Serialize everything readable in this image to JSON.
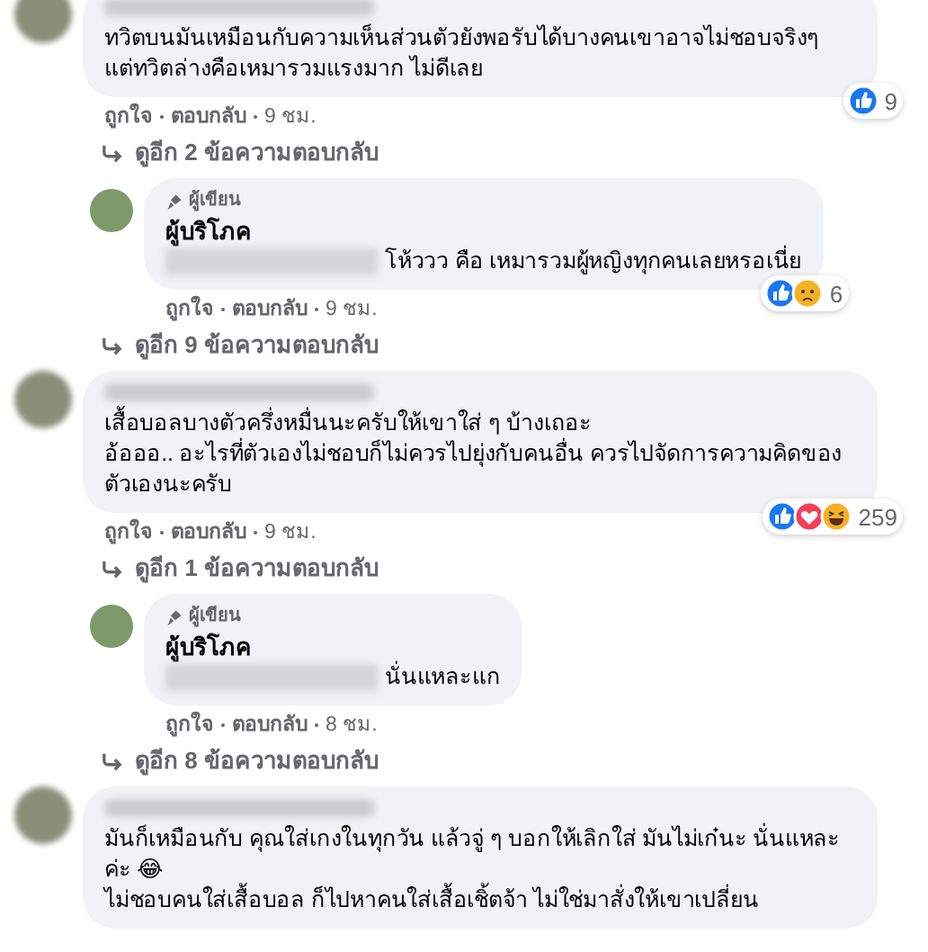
{
  "thread": [
    {
      "kind": "comment",
      "paragraphs": [
        "ทวิตบนมันเหมือนกับความเห็นส่วนตัวยังพอรับได้บางคนเขาอาจไม่ชอบจริงๆ",
        "แต่ทวิตล่างคือเหมารวมแรงมาก ไม่ดีเลย"
      ],
      "reactions": [
        {
          "kind": "like"
        }
      ],
      "reaction_count": "9",
      "actions": [
        "ถูกใจ",
        "ตอบกลับ",
        "9 ชม."
      ]
    },
    {
      "kind": "more_replies",
      "label": "ดูอีก 2 ข้อความตอบกลับ"
    },
    {
      "kind": "reply",
      "badge": "ผู้เขียน",
      "author": "ผู้บริโภค",
      "text": "โห้ววว คือ เหมารวมผู้หญิงทุกคนเลยหรอเนี่ย",
      "reactions": [
        {
          "kind": "like"
        },
        {
          "kind": "sad"
        }
      ],
      "reaction_count": "6",
      "actions": [
        "ถูกใจ",
        "ตอบกลับ",
        "9 ชม."
      ]
    },
    {
      "kind": "more_replies",
      "label": "ดูอีก 9 ข้อความตอบกลับ"
    },
    {
      "kind": "comment",
      "paragraphs": [
        "เสื้อบอลบางตัวครึ่งหมื่นนะครับให้เขาใส่ ๆ บ้างเถอะ",
        "อ้อออ.. อะไรที่ตัวเองไม่ชอบก็ไม่ควรไปยุ่งกับคนอื่น ควรไปจัดการความคิดของตัวเองนะครับ"
      ],
      "reactions": [
        {
          "kind": "like"
        },
        {
          "kind": "love"
        },
        {
          "kind": "haha"
        }
      ],
      "reaction_count": "259",
      "actions": [
        "ถูกใจ",
        "ตอบกลับ",
        "9 ชม."
      ]
    },
    {
      "kind": "more_replies",
      "label": "ดูอีก 1 ข้อความตอบกลับ"
    },
    {
      "kind": "reply",
      "badge": "ผู้เขียน",
      "author": "ผู้บริโภค",
      "text": "นั่นแหละแก",
      "actions": [
        "ถูกใจ",
        "ตอบกลับ",
        "8 ชม."
      ]
    },
    {
      "kind": "more_replies",
      "label": "ดูอีก 8 ข้อความตอบกลับ"
    },
    {
      "kind": "comment",
      "paragraphs": [
        "มันก็เหมือนกับ คุณใส่เกงในทุกวัน แล้วจู่ ๆ บอกให้เลิกใส่ มันไม่เก๋นะ นั่นแหละค่ะ 😂",
        "ไม่ชอบคนใส่เสื้อบอล ก็ไปหาคนใส่เสื้อเชิ้ตจ้า ไม่ใช่มาสั่งให้เขาเปลี่ยน"
      ]
    }
  ]
}
